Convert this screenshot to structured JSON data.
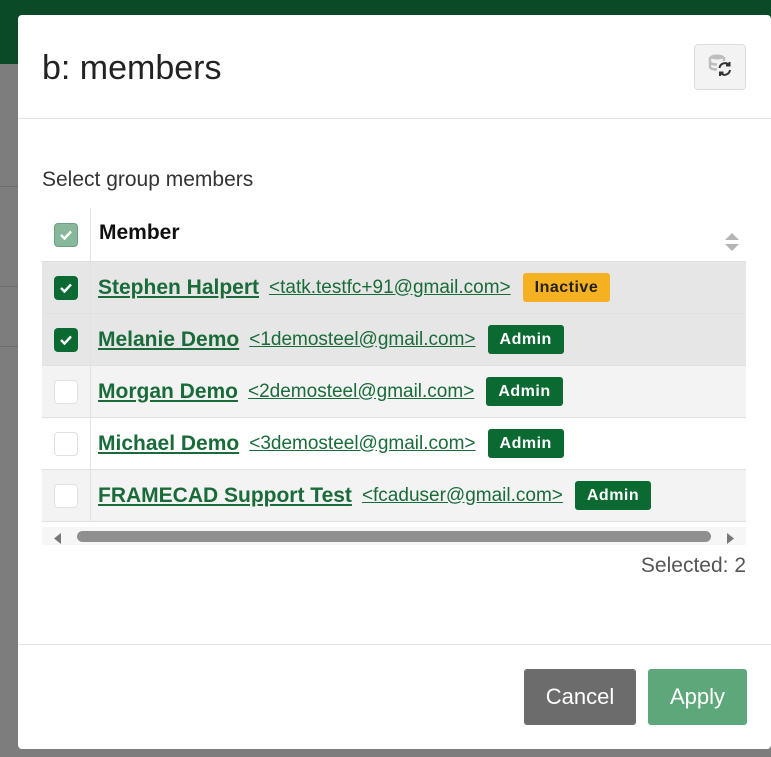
{
  "dialog": {
    "title": "b: members",
    "refresh_icon": "database-refresh-icon"
  },
  "section_label": "Select group members",
  "table": {
    "header": {
      "member_label": "Member",
      "select_all_checked": true
    },
    "rows": [
      {
        "name": "Stephen Halpert",
        "email": "<tatk.testfc+91@gmail.com>",
        "badge": "Inactive",
        "badge_type": "inactive",
        "checked": true
      },
      {
        "name": "Melanie Demo",
        "email": "<1demosteel@gmail.com>",
        "badge": "Admin",
        "badge_type": "admin",
        "checked": true
      },
      {
        "name": "Morgan Demo",
        "email": "<2demosteel@gmail.com>",
        "badge": "Admin",
        "badge_type": "admin",
        "checked": false
      },
      {
        "name": "Michael Demo",
        "email": "<3demosteel@gmail.com>",
        "badge": "Admin",
        "badge_type": "admin",
        "checked": false
      },
      {
        "name": "FRAMECAD Support Test",
        "email": "<fcaduser@gmail.com>",
        "badge": "Admin",
        "badge_type": "admin",
        "checked": false
      }
    ]
  },
  "selected_count_text": "Selected: 2",
  "footer": {
    "cancel_label": "Cancel",
    "apply_label": "Apply"
  },
  "colors": {
    "brand_green": "#0b6a32",
    "link_green": "#1a6b3a",
    "inactive_yellow": "#f5b121",
    "apply_green": "#5ea77a",
    "cancel_gray": "#6c6c6c"
  }
}
